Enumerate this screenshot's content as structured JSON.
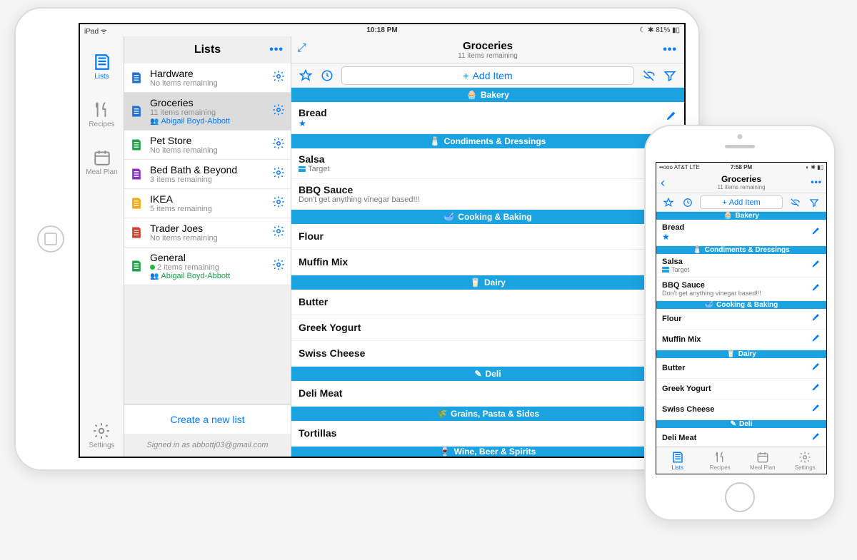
{
  "colors": {
    "accent": "#007aff",
    "section": "#1ba3e1"
  },
  "ipad": {
    "status": {
      "left": "iPad ᯤ",
      "time": "10:18 PM",
      "right": "☾ ✱ 81% ▮▯"
    },
    "rail": {
      "lists": "Lists",
      "recipes": "Recipes",
      "mealplan": "Meal Plan",
      "settings": "Settings"
    },
    "lists_header": {
      "title": "Lists",
      "more": "•••"
    },
    "lists": [
      {
        "name": "Hardware",
        "sub": "No items remaining",
        "color": "#1f6fd4"
      },
      {
        "name": "Groceries",
        "sub": "11 items remaining",
        "shared": "Abigail Boyd-Abbott",
        "color": "#1f6fd4",
        "selected": true
      },
      {
        "name": "Pet Store",
        "sub": "No items remaining",
        "color": "#1fa34a"
      },
      {
        "name": "Bed Bath & Beyond",
        "sub": "3 items remaining",
        "color": "#8a2fbf"
      },
      {
        "name": "IKEA",
        "sub": "5 items remaining",
        "color": "#f2a900"
      },
      {
        "name": "Trader Joes",
        "sub": "No items remaining",
        "color": "#d23b2c"
      },
      {
        "name": "General",
        "sub": "2 items remaining",
        "shared": "Abigail Boyd-Abbott",
        "color": "#1fa34a",
        "badge": true
      }
    ],
    "create": "Create a new list",
    "signed_in": "Signed in as abbottj03@gmail.com",
    "detail": {
      "title": "Groceries",
      "sub": "11 items remaining",
      "more": "•••",
      "expand": "⤢",
      "add_item": "Add Item"
    },
    "sections": [
      {
        "header": "Bakery",
        "icon": "🧁",
        "items": [
          {
            "name": "Bread",
            "starred": true
          }
        ]
      },
      {
        "header": "Condiments & Dressings",
        "icon": "🧂",
        "items": [
          {
            "name": "Salsa",
            "store": "Target"
          },
          {
            "name": "BBQ Sauce",
            "note": "Don't get anything vinegar based!!!"
          }
        ]
      },
      {
        "header": "Cooking & Baking",
        "icon": "🥣",
        "items": [
          {
            "name": "Flour"
          },
          {
            "name": "Muffin Mix"
          }
        ]
      },
      {
        "header": "Dairy",
        "icon": "🥛",
        "items": [
          {
            "name": "Butter"
          },
          {
            "name": "Greek Yogurt"
          },
          {
            "name": "Swiss Cheese"
          }
        ]
      },
      {
        "header": "Deli",
        "icon": "✎",
        "items": [
          {
            "name": "Deli Meat"
          }
        ]
      },
      {
        "header": "Grains, Pasta & Sides",
        "icon": "🌾",
        "items": [
          {
            "name": "Tortillas"
          }
        ]
      },
      {
        "header": "Wine, Beer & Spirits",
        "icon": "🍷",
        "partial": true,
        "items": []
      }
    ]
  },
  "iphone": {
    "status": {
      "left": "••ooo AT&T  LTE",
      "time": "7:58 PM",
      "right": "◐ ✱ ▮▯"
    },
    "header": {
      "title": "Groceries",
      "sub": "11 items remaining",
      "more": "•••"
    },
    "add_item": "Add Item",
    "sections": [
      {
        "header": "Bakery",
        "icon": "🧁",
        "items": [
          {
            "name": "Bread",
            "starred": true
          }
        ]
      },
      {
        "header": "Condiments & Dressings",
        "icon": "🧂",
        "items": [
          {
            "name": "Salsa",
            "store": "Target"
          },
          {
            "name": "BBQ Sauce",
            "note": "Don't get anything vinegar based!!!"
          }
        ]
      },
      {
        "header": "Cooking & Baking",
        "icon": "🥣",
        "items": [
          {
            "name": "Flour"
          },
          {
            "name": "Muffin Mix"
          }
        ]
      },
      {
        "header": "Dairy",
        "icon": "🥛",
        "items": [
          {
            "name": "Butter"
          },
          {
            "name": "Greek Yogurt"
          },
          {
            "name": "Swiss Cheese"
          }
        ]
      },
      {
        "header": "Deli",
        "icon": "✎",
        "items": [
          {
            "name": "Deli Meat"
          }
        ]
      }
    ],
    "tabs": {
      "lists": "Lists",
      "recipes": "Recipes",
      "mealplan": "Meal Plan",
      "settings": "Settings"
    }
  }
}
